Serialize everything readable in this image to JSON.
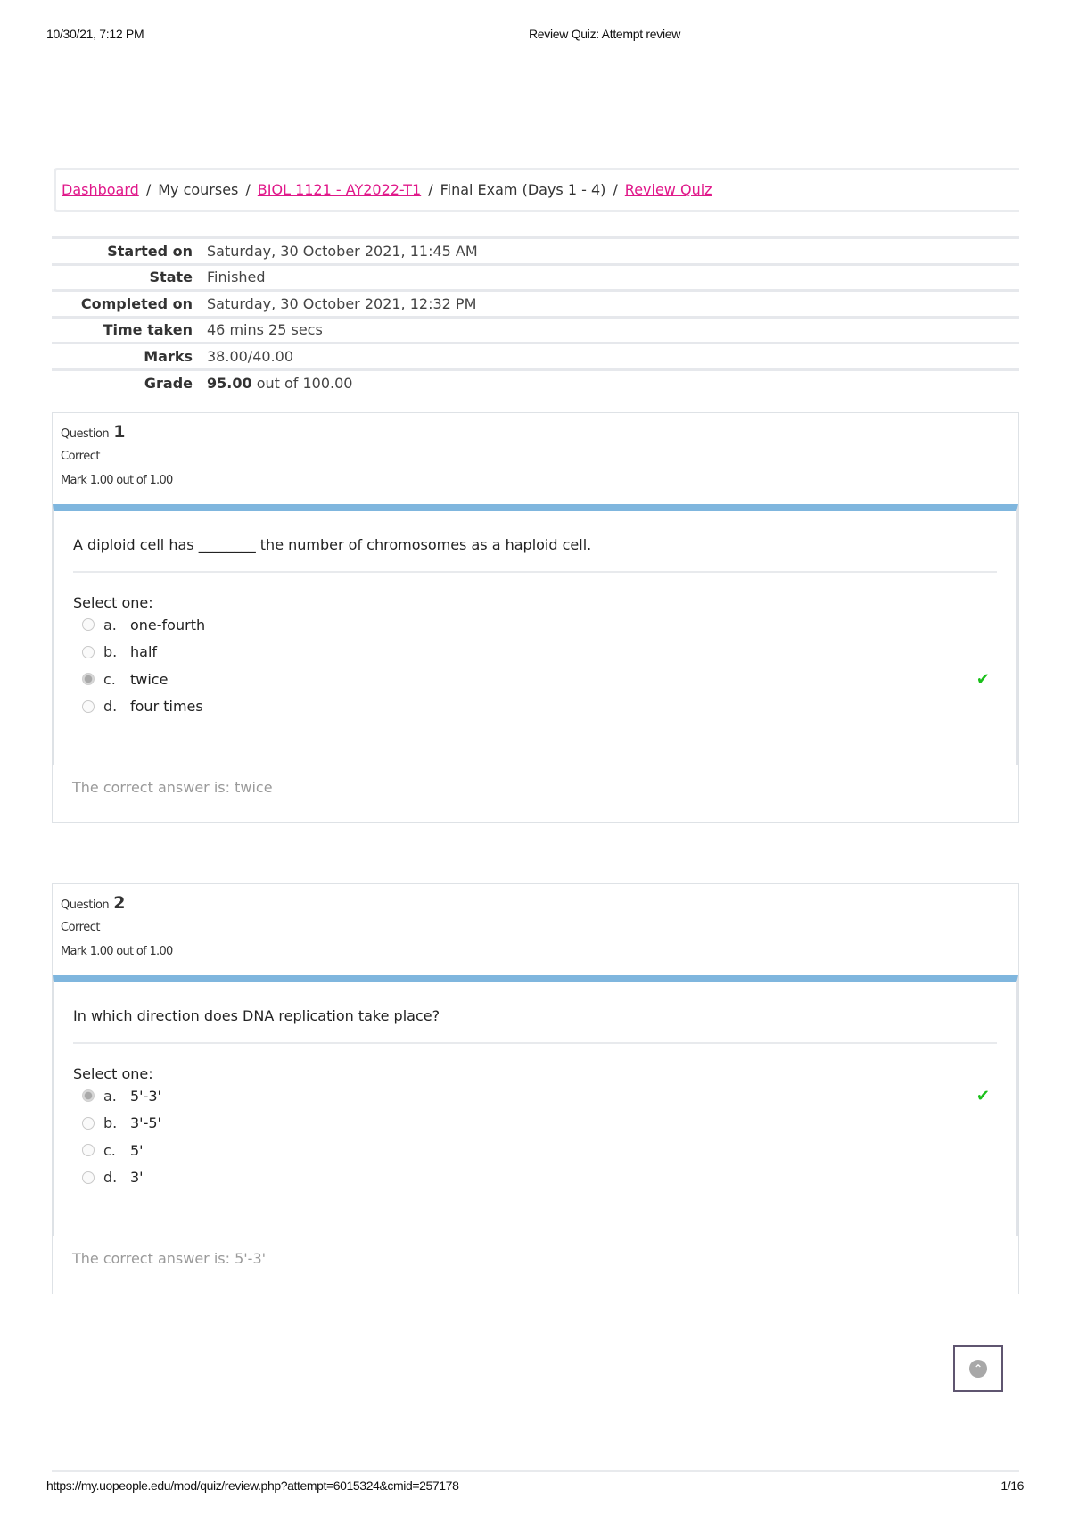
{
  "print_header": {
    "date": "10/30/21, 7:12 PM",
    "title": "Review Quiz: Attempt review"
  },
  "breadcrumb": {
    "items": [
      {
        "label": "Dashboard",
        "link": true
      },
      {
        "label": "My courses",
        "link": false
      },
      {
        "label": "BIOL 1121 - AY2022-T1",
        "link": true
      },
      {
        "label": "Final Exam (Days 1 - 4)",
        "link": false
      },
      {
        "label": "Review Quiz",
        "link": true
      }
    ],
    "separator": "/"
  },
  "summary": {
    "rows": [
      {
        "label": "Started on",
        "value": "Saturday, 30 October 2021, 11:45 AM"
      },
      {
        "label": "State",
        "value": "Finished"
      },
      {
        "label": "Completed on",
        "value": "Saturday, 30 October 2021, 12:32 PM"
      },
      {
        "label": "Time taken",
        "value": "46 mins 25 secs"
      },
      {
        "label": "Marks",
        "value": "38.00/40.00"
      },
      {
        "label": "Grade",
        "value_bold": "95.00",
        "value": " out of 100.00"
      }
    ]
  },
  "questions": [
    {
      "label": "Question",
      "number": "1",
      "state": "Correct",
      "mark": "Mark 1.00 out of 1.00",
      "text": "A diploid cell has ________ the number of chromosomes as a haploid cell.",
      "prompt": "Select one:",
      "answers": [
        {
          "letter": "a.",
          "text": "one-fourth",
          "selected": false
        },
        {
          "letter": "b.",
          "text": "half",
          "selected": false
        },
        {
          "letter": "c.",
          "text": "twice",
          "selected": true
        },
        {
          "letter": "d.",
          "text": "four times",
          "selected": false
        }
      ],
      "result_icon": "check-icon",
      "feedback": "The correct answer is: twice"
    },
    {
      "label": "Question",
      "number": "2",
      "state": "Correct",
      "mark": "Mark 1.00 out of 1.00",
      "text": "In which direction does DNA replication take place?",
      "prompt": "Select one:",
      "answers": [
        {
          "letter": "a.",
          "text": "5'-3'",
          "selected": true
        },
        {
          "letter": "b.",
          "text": "3'-5'",
          "selected": false
        },
        {
          "letter": "c.",
          "text": "5'",
          "selected": false
        },
        {
          "letter": "d.",
          "text": "3'",
          "selected": false
        }
      ],
      "result_icon": "check-icon",
      "feedback": "The correct answer is: 5'-3'"
    }
  ],
  "colors": {
    "link": "#e0188a",
    "question_bar": "#7fb6de",
    "correct_tick": "#1ac01a"
  },
  "print_footer": {
    "url": "https://my.uopeople.edu/mod/quiz/review.php?attempt=6015324&cmid=257178",
    "page": "1/16"
  },
  "icons": {
    "check": "✔",
    "back_to_top": "⌃"
  }
}
